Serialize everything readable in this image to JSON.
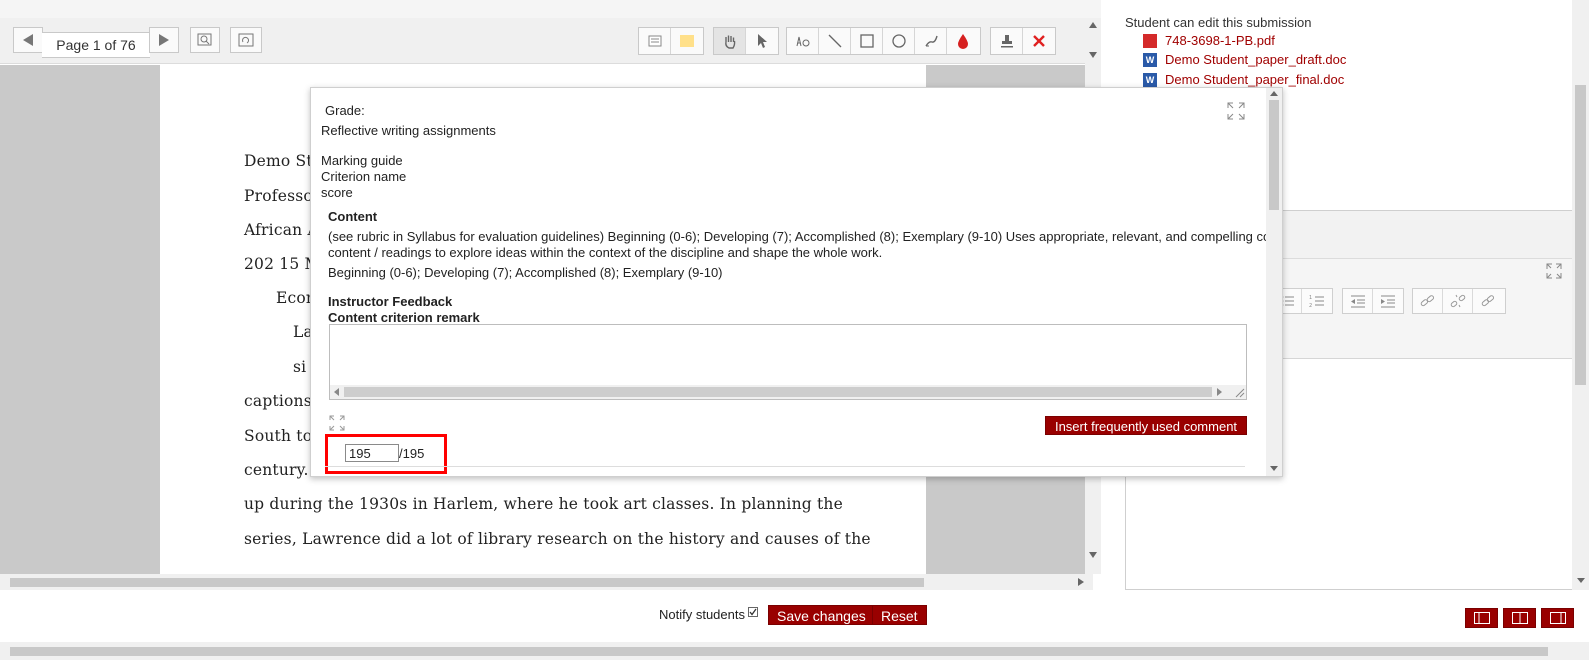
{
  "toolbar": {
    "page_label": "Page 1 of 76",
    "icons": [
      "prev-page-icon",
      "next-page-icon",
      "search-icon",
      "rotate-icon",
      "comment-icon",
      "highlight-color-icon",
      "hand-icon",
      "select-pointer-icon",
      "oval-tool-icon",
      "line-icon",
      "rectangle-icon",
      "circle-icon",
      "pen-icon",
      "color-drop-icon",
      "stamp-icon",
      "delete-icon"
    ]
  },
  "pdf": {
    "lines": [
      "Demo St",
      "Professor",
      "African A",
      "202 15 M",
      "Econ",
      "La",
      "si",
      "captions)",
      "South to",
      "century. \"",
      "up during the 1930s in Harlem, where he took art classes. In planning the",
      "series, Lawrence did a lot of library research on the history and causes of the"
    ]
  },
  "right_panel": {
    "editable_note": "Student can edit this submission",
    "files": [
      {
        "name": "748-3698-1-PB.pdf",
        "type": "pdf"
      },
      {
        "name": "Demo Student_paper_draft.doc",
        "type": "word"
      },
      {
        "name": "Demo Student_paper_final.doc",
        "type": "word"
      }
    ]
  },
  "popup": {
    "grade_label": "Grade:",
    "assignment": "Reflective writing assignments",
    "marking_guide": "Marking guide",
    "criterion_name": "Criterion name",
    "score_header": "score",
    "criterion_title": "Content",
    "criterion_desc_1": "(see rubric in Syllabus for evaluation guidelines) Beginning (0-6); Developing (7); Accomplished (8); Exemplary (9-10) Uses appropriate, relevant, and compelling course",
    "criterion_desc_2": "content / readings to explore ideas within the context of the discipline and shape the whole work.",
    "criterion_levels": "Beginning (0-6); Developing (7); Accomplished (8); Exemplary (9-10)",
    "feedback_title": "Instructor Feedback",
    "remark_label": "Content criterion remark",
    "insert_button": "Insert frequently used comment",
    "score_value": "195",
    "score_max": "/195"
  },
  "footer": {
    "notify_label": "Notify students",
    "notify_checked": true,
    "save_button": "Save changes",
    "reset_button": "Reset"
  },
  "colors": {
    "accent": "#990000",
    "link": "#a00000",
    "highlight_box": "#ff0000"
  }
}
